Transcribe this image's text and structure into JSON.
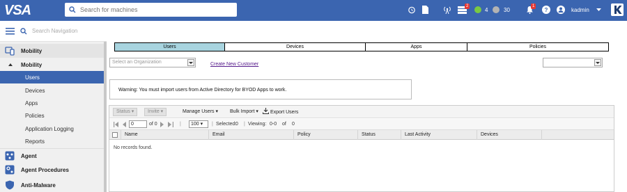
{
  "topbar": {
    "logo": "VSA",
    "search_placeholder": "Search for machines",
    "notifications_badge": "2",
    "alerts_badge": "1",
    "online_count": "4",
    "offline_count": "30",
    "username": "kadmin",
    "brand_letter": "K"
  },
  "nav": {
    "search_placeholder": "Search Navigation",
    "module": "Mobility",
    "group": "Mobility",
    "items": [
      "Users",
      "Devices",
      "Apps",
      "Policies",
      "Application Logging",
      "Reports"
    ],
    "other_modules": [
      "Agent",
      "Agent Procedures",
      "Anti-Malware"
    ]
  },
  "tabs": [
    "Users",
    "Devices",
    "Apps",
    "Policies"
  ],
  "org_select_placeholder": "Select an Organization",
  "create_link": "Create New Customer",
  "warning_text": "Warning: You must import users from Active Directory for BYOD Apps to work.",
  "toolbar": {
    "status": "Status",
    "invite": "Invite",
    "manage": "Manage Users",
    "bulk": "Bulk Import",
    "export": "Export Users"
  },
  "pager": {
    "page": "0",
    "of": "of 0",
    "page_size": "100",
    "selected_label": "Selected:",
    "selected": "0",
    "viewing_label": "Viewing:",
    "viewing": "0-0",
    "of_label": "of",
    "total": "0"
  },
  "columns": [
    "Name",
    "Email",
    "Policy",
    "Status",
    "Last Activity",
    "Devices"
  ],
  "empty_text": "No records found."
}
